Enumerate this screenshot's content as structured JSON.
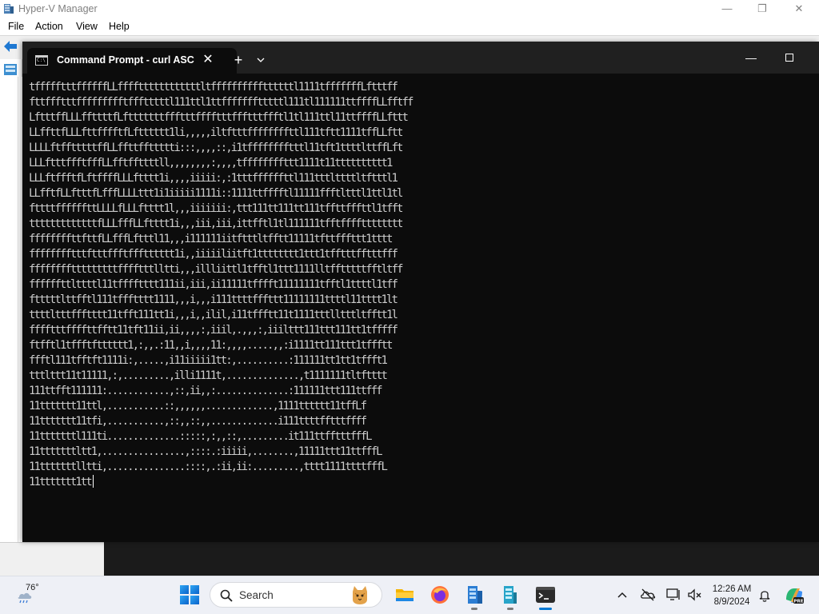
{
  "hyperv": {
    "title": "Hyper-V Manager",
    "menu": [
      "File",
      "Action",
      "View",
      "Help"
    ],
    "caption": {
      "minimize": "—",
      "restore": "❐",
      "close": "✕"
    }
  },
  "cmd": {
    "tab_title": "Command Prompt - curl  ASC",
    "tab_close": "✕",
    "new_tab": "+",
    "dropdown": "⌵",
    "minimize": "—",
    "lines": [
      "tffffftttffffffLLffffttttttttttttltffffffffffttttttl1111tfffffffLftttff",
      "fttffftttffffffffftffftttttl111ttl1ttffffffftttttl111tl111111ttffffLLfftff",
      "LftttffLLLffttttfLftttttttffftttfffftttffftttffftl1tl111ttl11ttffffLLfttt",
      "LLffttfLLLfttfffftfLftttttt1li,,,,,iltftttffffffffttl111tftt1111tffLLftt",
      "LLLLftfftttttffLLffttffttttti:::,,,,::,i1tfffffffftttl11tft1ttttlttffLft",
      "LLLftttffftfffLLfftffttttll,,,,,,,,:,,,,tffffffffttt1111t11tttttttttt1",
      "LLLftffftfLftffffLLLftttt1i,,,,iiiii:,:1tttffffffttl111tttlttttltftttl1",
      "LLfftfLLftttfLfffLLLLttt1i1iiiii1111i::1111ttfffftl11111ffftltttl1ttl1tl",
      "fttttffffffttLLLLfLLLftttt1l,,,iiiiiii:,ttt111tt111tt111tffttfffttl1tfft",
      "tttttttttttttfLLLfffLLftttt1i,,,iii,iii,ittfftl1tl111111tfftfffftttttttt",
      "ffffffffttfttfLLfffLftttl11,,,i111111iitftttltfftt11111tfttfffttt1tttt",
      "fffffffftttftttffftffftttttt1i,,iiiiiliitft1tttttttt1ttt1tfftttfftttfff",
      "fffffffftttttttttfffftttlltti,,,illliittl1tfftl1ttt1111lltfftttttfftltff",
      "ffffffttlttttl11tfffftttt111ii,iii,ii11111tfffft11111111tfftl1ttttl1tff",
      "ftttttlttfftl111tffftttt1111,,,i,,,i111ttttfffttt11111111ttttl11tttt1lt",
      "ttttltttffftttt11tfft111tt1i,,,i,,ilil,i11tffftt11t1111tttlltttltfftt1l",
      "fffftttffffttfftt11tft11ii,ii,,,,:,iiil,.,,,:,iiilttt111ttt111tt1tfffff",
      "ftfftl1tffftftttttt1,:,,.:11,,i,,,,11:,,,,.....,,:i1111tt111ttt1tffftt",
      "ffftl111tfftft1111i:,.....,i11iiiii1tt:,..........:111111tt1tt1tffft1",
      "tttlttt11t11111,:,.........,illi1111t,..............,t1111111tltftttt",
      "111ttfft111111:............,::,ii,,:..............:111111ttt111ttfff",
      "11ttttttt11ttl,...........::,,,,,,.............,1111tttttt11tffLf",
      "11ttttttt11tfi,...........,::,,::,,.............i111ttttfftttffff",
      "11tttttttl111ti..............:::::,:,,::,.........it111ttfftttfffL",
      "11tttttttltt1,................,::::.:iiiii,........,11111ttt11ttfffL",
      "11tttttttlltti,...............::::,.:ii,ii:.........,tttt1111ttttfffL",
      "11ttttttt1tt"
    ]
  },
  "taskbar": {
    "weather_temp": "76°",
    "search_placeholder": "Search",
    "clock_time": "12:26 AM",
    "clock_date": "8/9/2024"
  },
  "colors": {
    "terminal_bg": "#0c0c0c",
    "terminal_text": "#cccccc",
    "tabstrip": "#202020",
    "taskbar": "#eef0f6",
    "accent": "#0078d4"
  }
}
